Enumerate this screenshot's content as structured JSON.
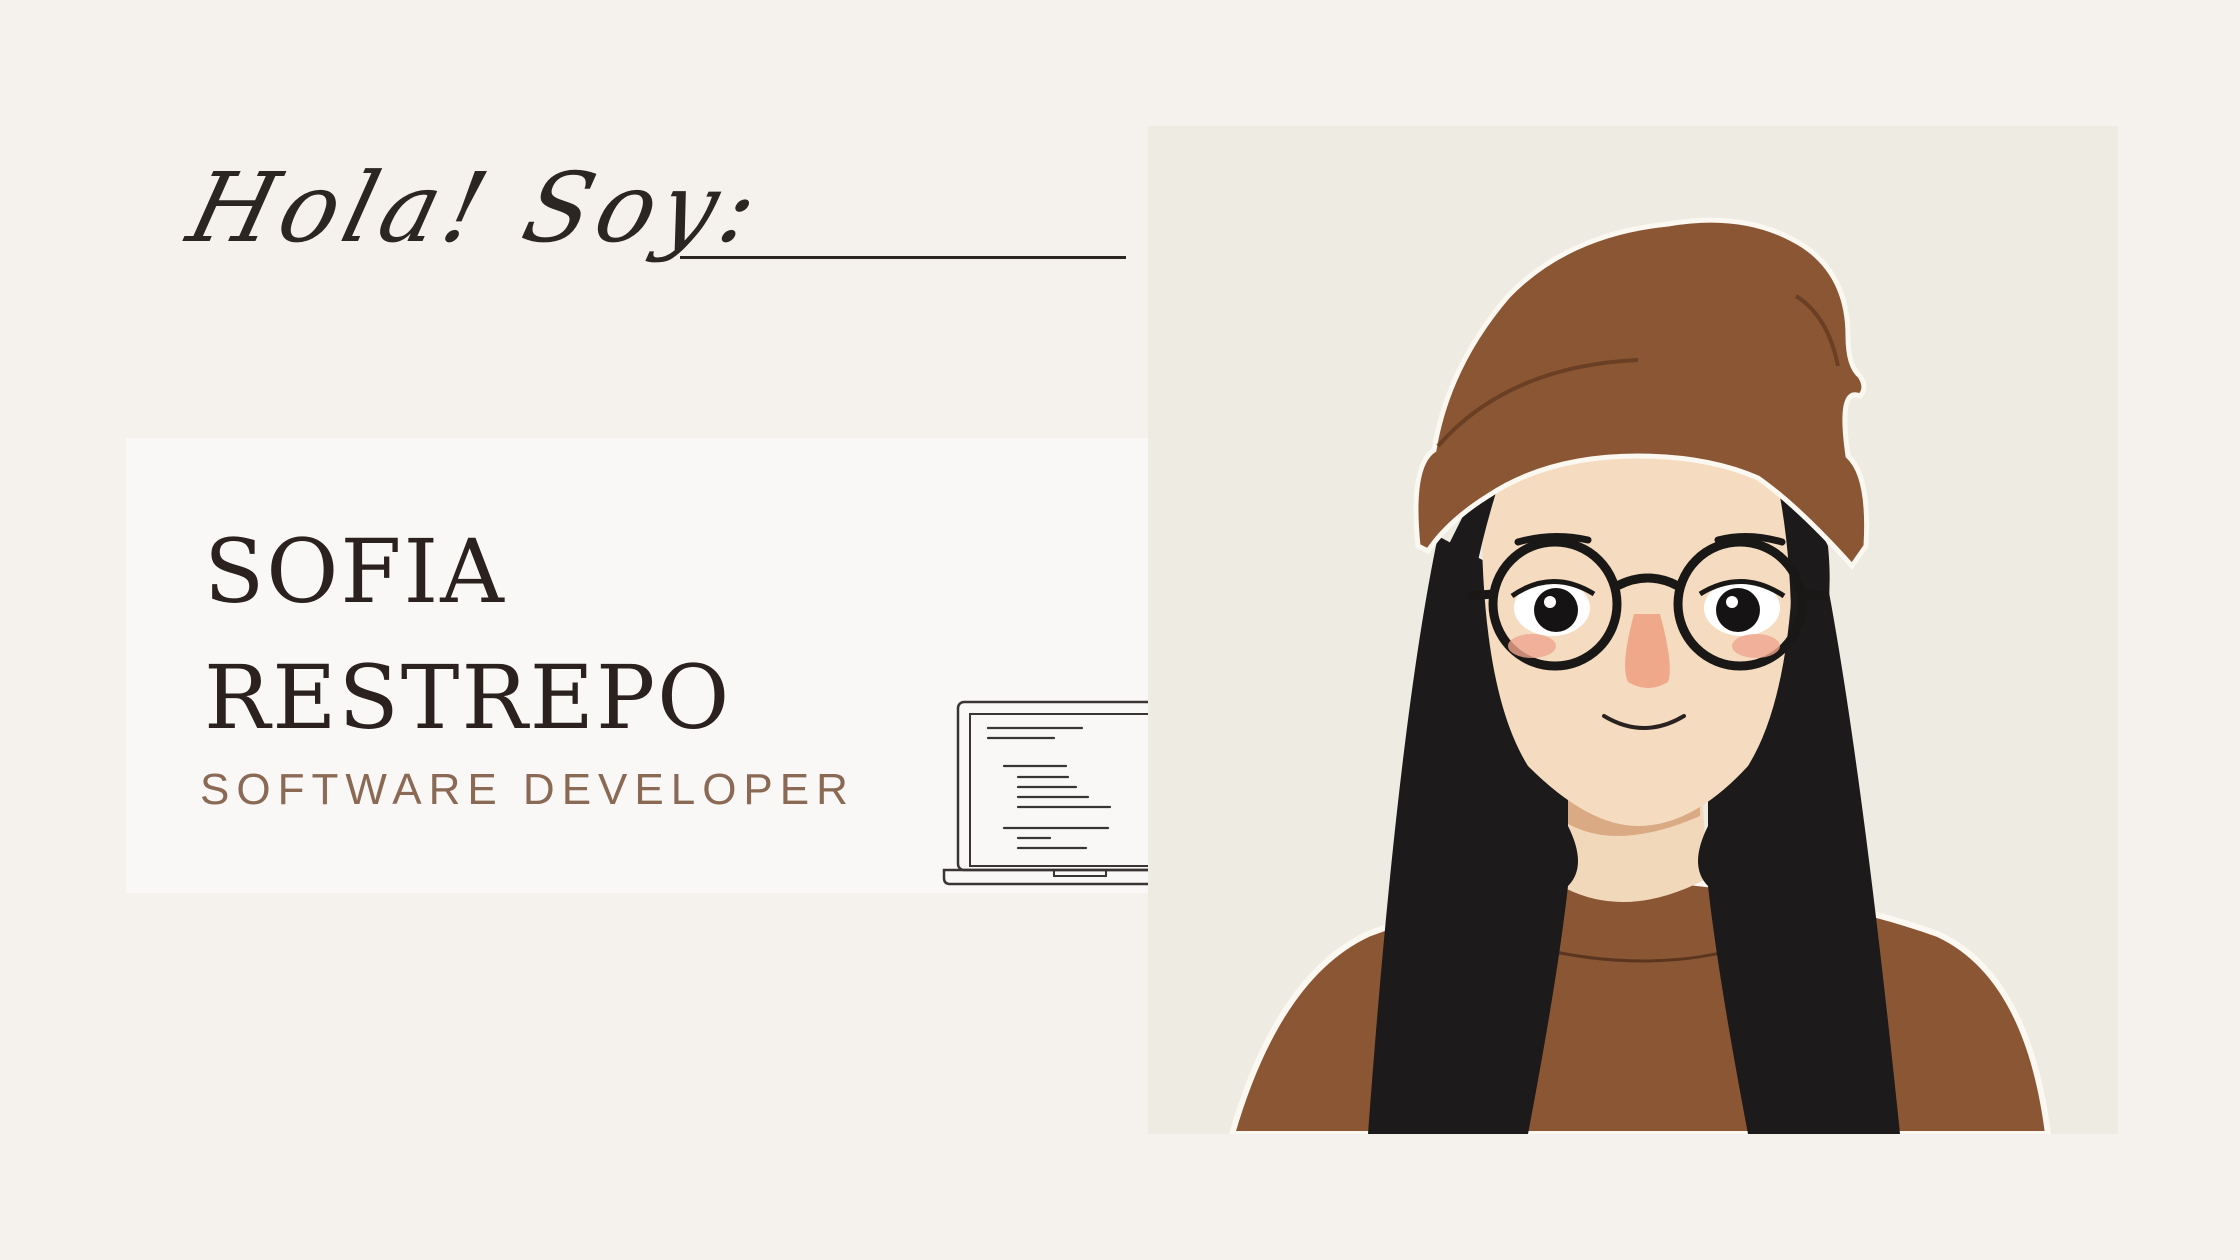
{
  "slide": {
    "greeting": "Hola! Soy:",
    "name_first": "SOFIA",
    "name_last": "RESTREPO",
    "role": "SOFTWARE DEVELOPER"
  },
  "icons": {
    "laptop": "laptop-icon",
    "avatar": "avatar-illustration"
  },
  "colors": {
    "background": "#f5f1ed",
    "card": "#faf8f6",
    "accent": "#8b6a55",
    "beanie": "#8b5634",
    "hair": "#1c1a1a",
    "skin": "#f5dcc0"
  }
}
